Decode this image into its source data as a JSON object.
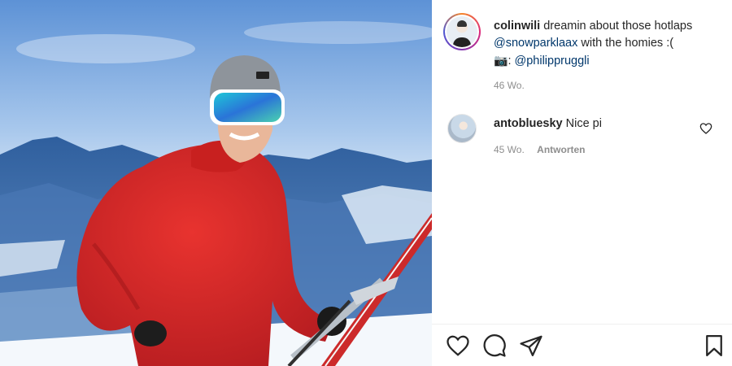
{
  "post": {
    "username": "colinwili",
    "caption_text": "dreamin about those hotlaps",
    "mention_1": "@snowparklaax",
    "caption_after_mention": "with the homies :(",
    "camera_glyph": "📷",
    "colon": ":",
    "mention_2": "@philippruggli",
    "timestamp": "46 Wo."
  },
  "comments": [
    {
      "username": "antoblueskу",
      "text": "Nice pi",
      "timestamp": "45 Wo.",
      "reply_label": "Antworten"
    }
  ],
  "icons": {
    "like": "heart-outline-icon",
    "comment": "speech-bubble-icon",
    "share": "paper-plane-icon",
    "save": "bookmark-icon",
    "comment_like": "small-heart-icon"
  },
  "colors": {
    "mention": "#00376b",
    "muted": "#8e8e8e",
    "text": "#262626",
    "hoodie": "#d8262b"
  }
}
